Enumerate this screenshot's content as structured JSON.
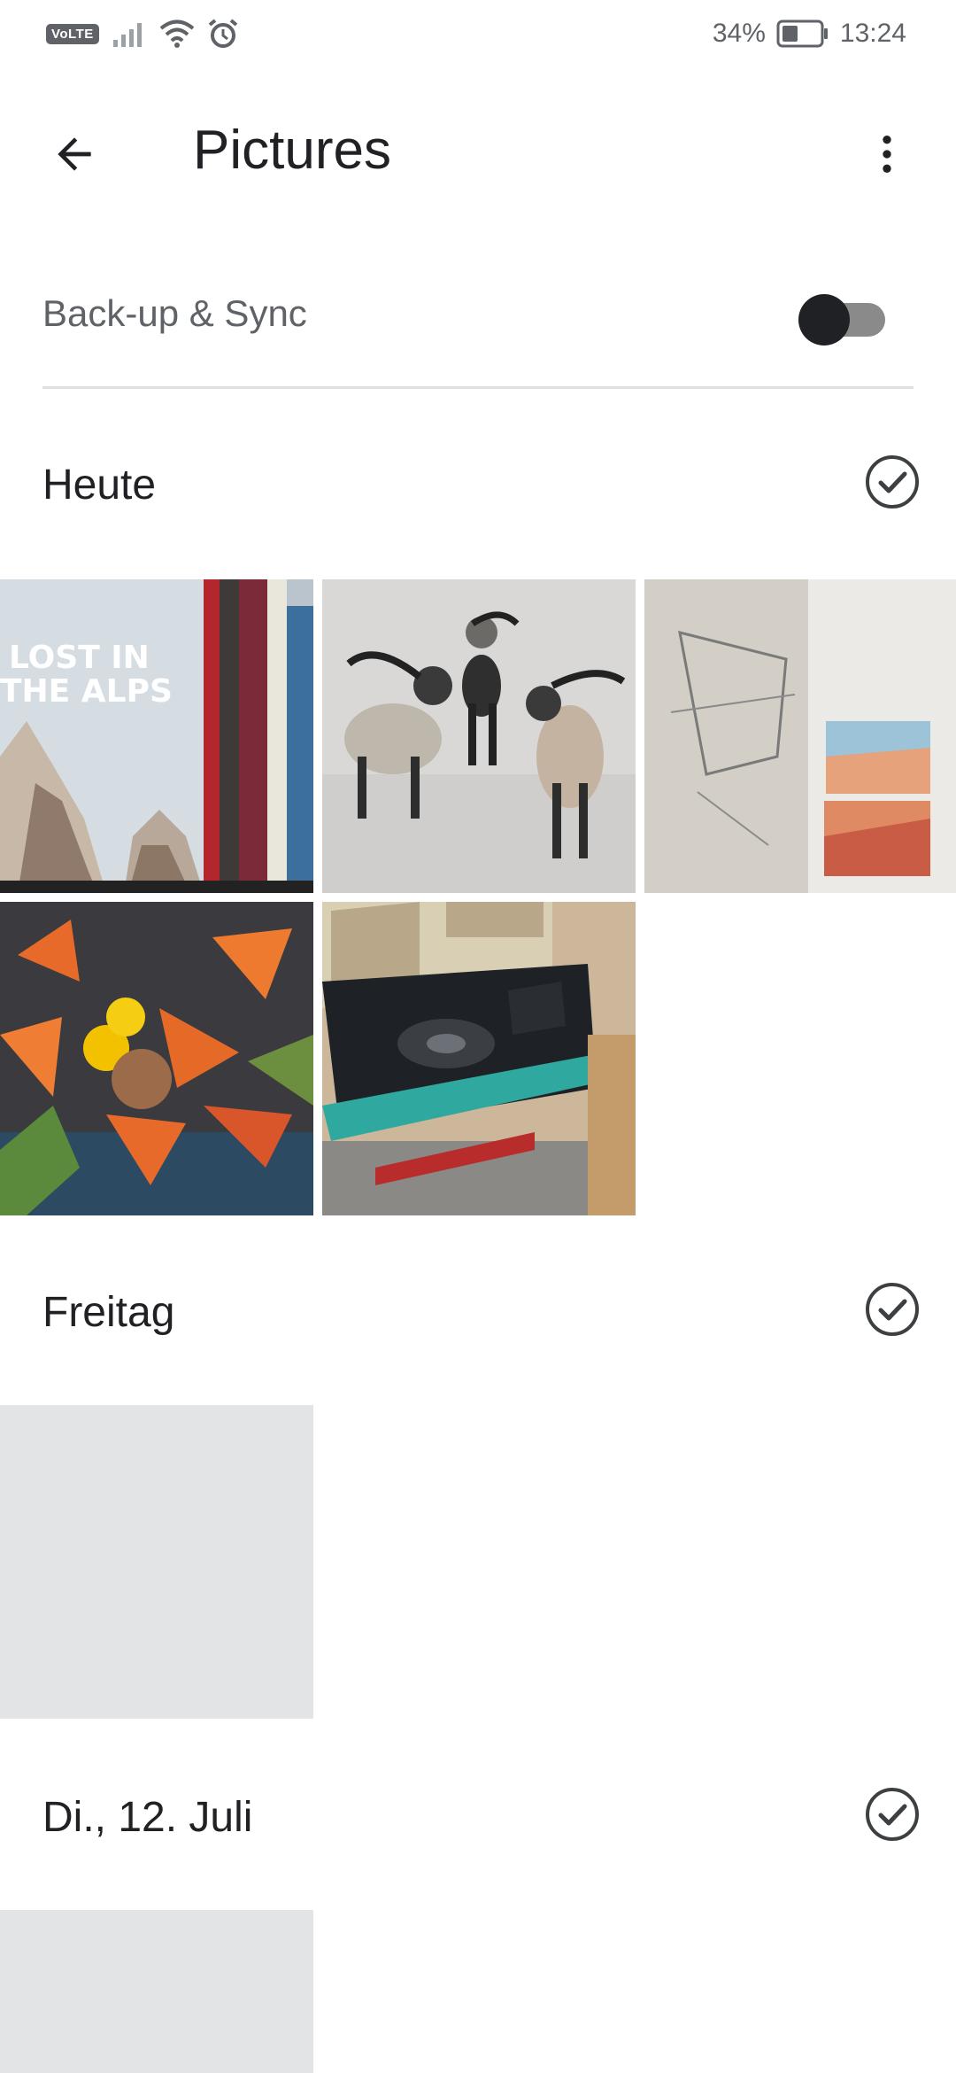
{
  "status_bar": {
    "volte": "VoLTE",
    "battery": "34%",
    "time": "13:24",
    "icons": [
      "signal-icon",
      "wifi-icon",
      "alarm-icon",
      "battery-icon"
    ]
  },
  "header": {
    "title": "Pictures",
    "icons": [
      "back-arrow-icon",
      "more-vert-icon"
    ]
  },
  "backup": {
    "label": "Back-up & Sync",
    "enabled": false
  },
  "sections": [
    {
      "label": "Heute",
      "photos": [
        {
          "subject": "Books – Lost in the Alps"
        },
        {
          "subject": "Goat figurines"
        },
        {
          "subject": "Wall paintings"
        },
        {
          "subject": "Orange flower bouquet"
        },
        {
          "subject": "Jukebox"
        }
      ]
    },
    {
      "label": "Freitag",
      "photos": [
        {
          "subject": "placeholder"
        }
      ]
    },
    {
      "label": "Di., 12. Juli",
      "photos": [
        {
          "subject": "placeholder"
        }
      ]
    }
  ],
  "colors": {
    "accent_text": "#202124",
    "secondary_text": "#5f6368",
    "placeholder": "#e3e4e6"
  }
}
